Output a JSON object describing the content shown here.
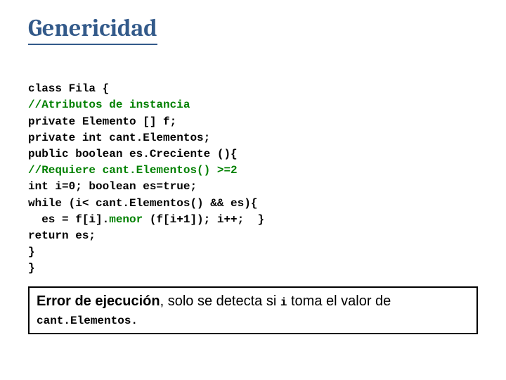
{
  "title": "Genericidad",
  "code": {
    "l1": "class Fila {",
    "l2": "//Atributos de instancia",
    "l3": "private Elemento [] f;",
    "l4": "private int cant.Elementos;",
    "l5": "public boolean es.Creciente (){",
    "l6": "//Requiere cant.Elementos() >=2",
    "l7": "int i=0; boolean es=true;",
    "l8": "while (i< cant.Elementos() && es){",
    "l9a": "  es = f[i].",
    "l9b": "menor",
    "l9c": " (f[i+1]); i++;  }",
    "l10": "return es;",
    "l11": "}",
    "l12": "}"
  },
  "note": {
    "t1": "Error de ejecución",
    "t2": ", solo se detecta si ",
    "t3": "i",
    "t4": " toma el valor de ",
    "t5": "cant.Elementos.",
    "period": ""
  }
}
